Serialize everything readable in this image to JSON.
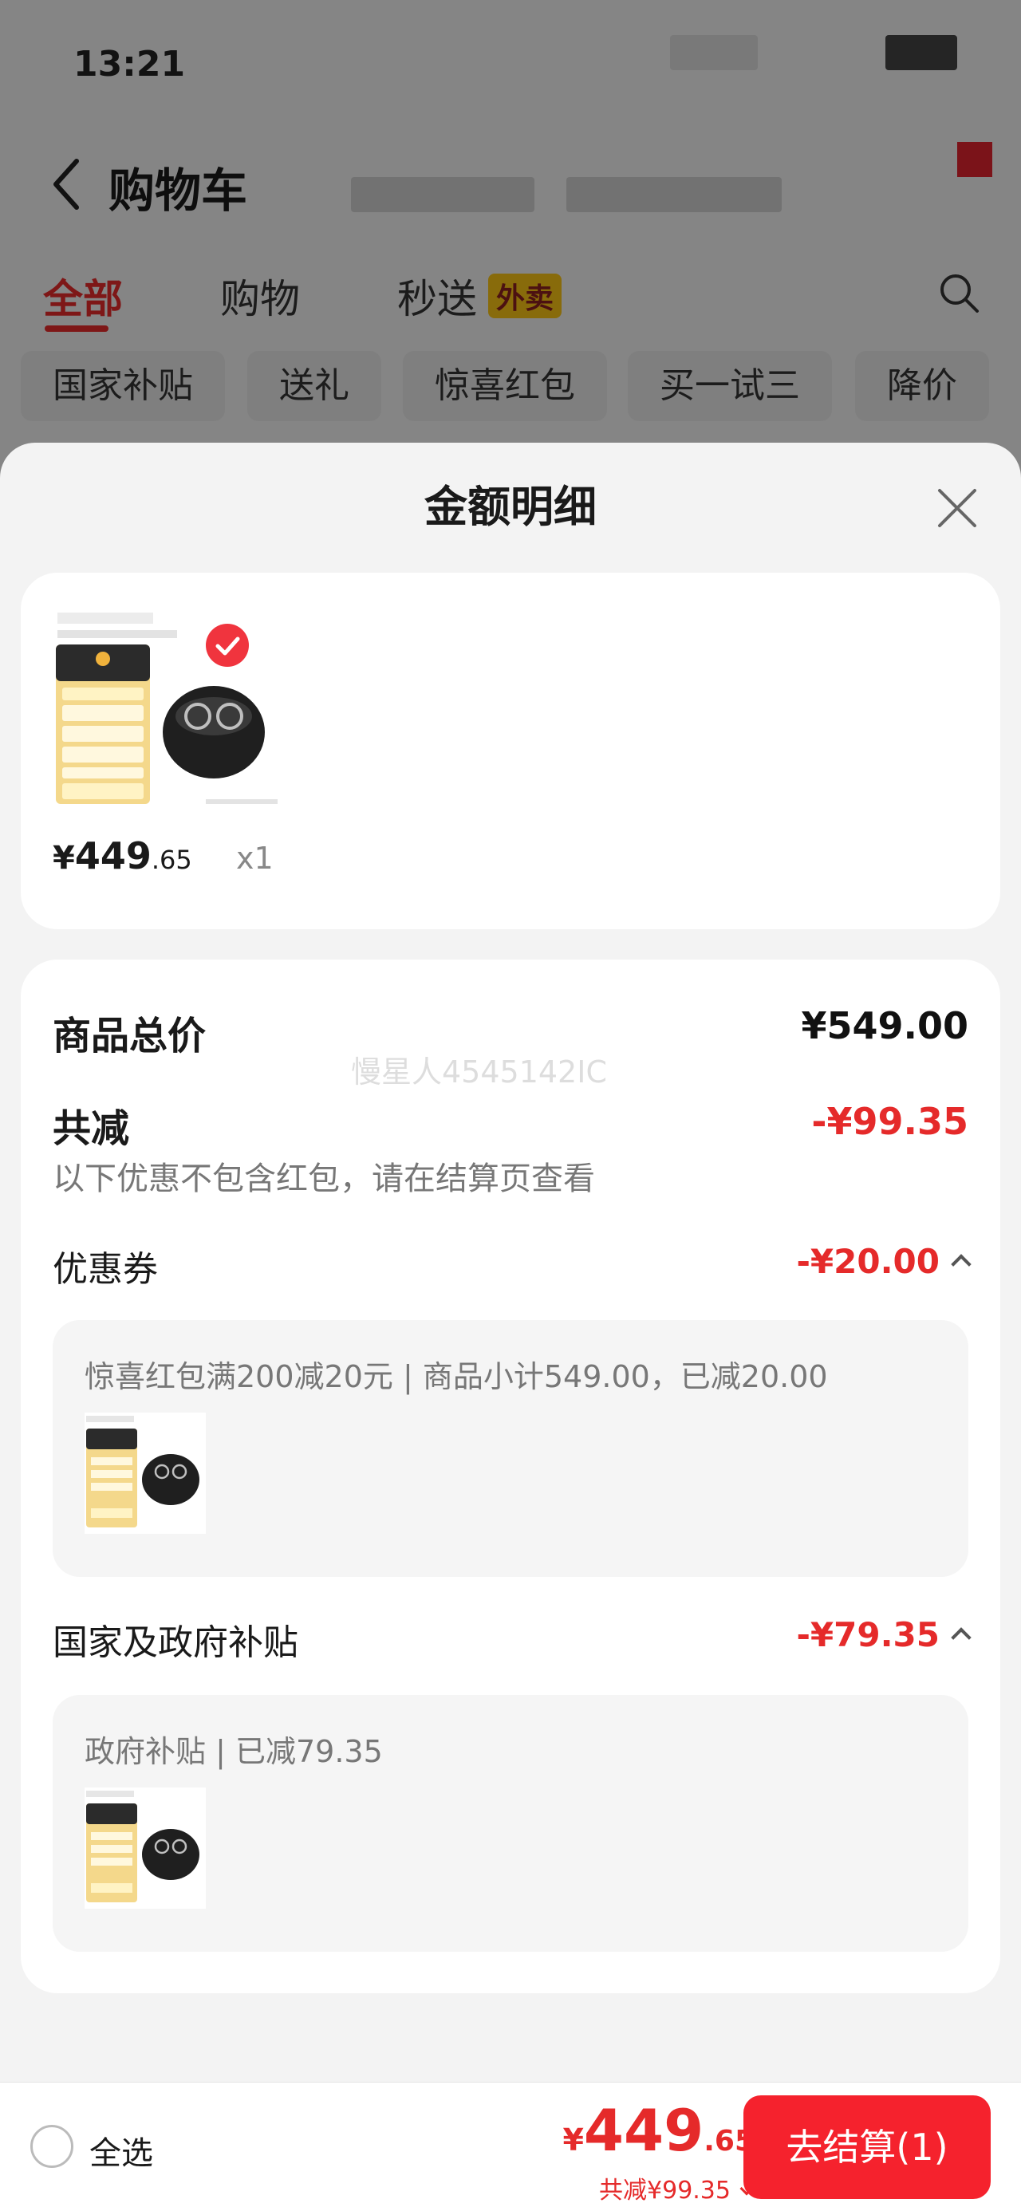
{
  "status_bar": {
    "time": "13:21"
  },
  "cart_page": {
    "title": "购物车",
    "tabs": [
      {
        "label": "全部",
        "active": true
      },
      {
        "label": "购物",
        "active": false
      },
      {
        "label": "秒送",
        "active": false,
        "badge": "外卖"
      }
    ],
    "chips": [
      "国家补贴",
      "送礼",
      "惊喜红包",
      "买一试三",
      "降价"
    ]
  },
  "sheet": {
    "title": "金额明细",
    "product": {
      "price_symbol": "¥",
      "price_int": "449",
      "price_dec": ".65",
      "quantity": "x1",
      "selected": true
    },
    "summary": {
      "total_label": "商品总价",
      "total_value": "¥549.00",
      "reduced_label": "共减",
      "reduced_value": "-¥99.35",
      "note": "以下优惠不包含红包，请在结算页查看",
      "watermark": "慢星人4545142IC"
    },
    "coupon": {
      "label": "优惠券",
      "value": "-¥20.00",
      "detail": "惊喜红包满200减20元 | 商品小计549.00，已减20.00"
    },
    "subsidy": {
      "label": "国家及政府补贴",
      "value": "-¥79.35",
      "detail": "政府补贴 | 已减79.35"
    }
  },
  "bottom_bar": {
    "select_all_label": "全选",
    "total_symbol": "¥",
    "total_int": "449",
    "total_dec": ".65",
    "saved_text": "共减¥99.35",
    "checkout_label": "去结算(1)"
  },
  "colors": {
    "accent_red": "#e52a2a",
    "checkout_red": "#f5222d",
    "takeout_yellow": "#f7c315"
  }
}
